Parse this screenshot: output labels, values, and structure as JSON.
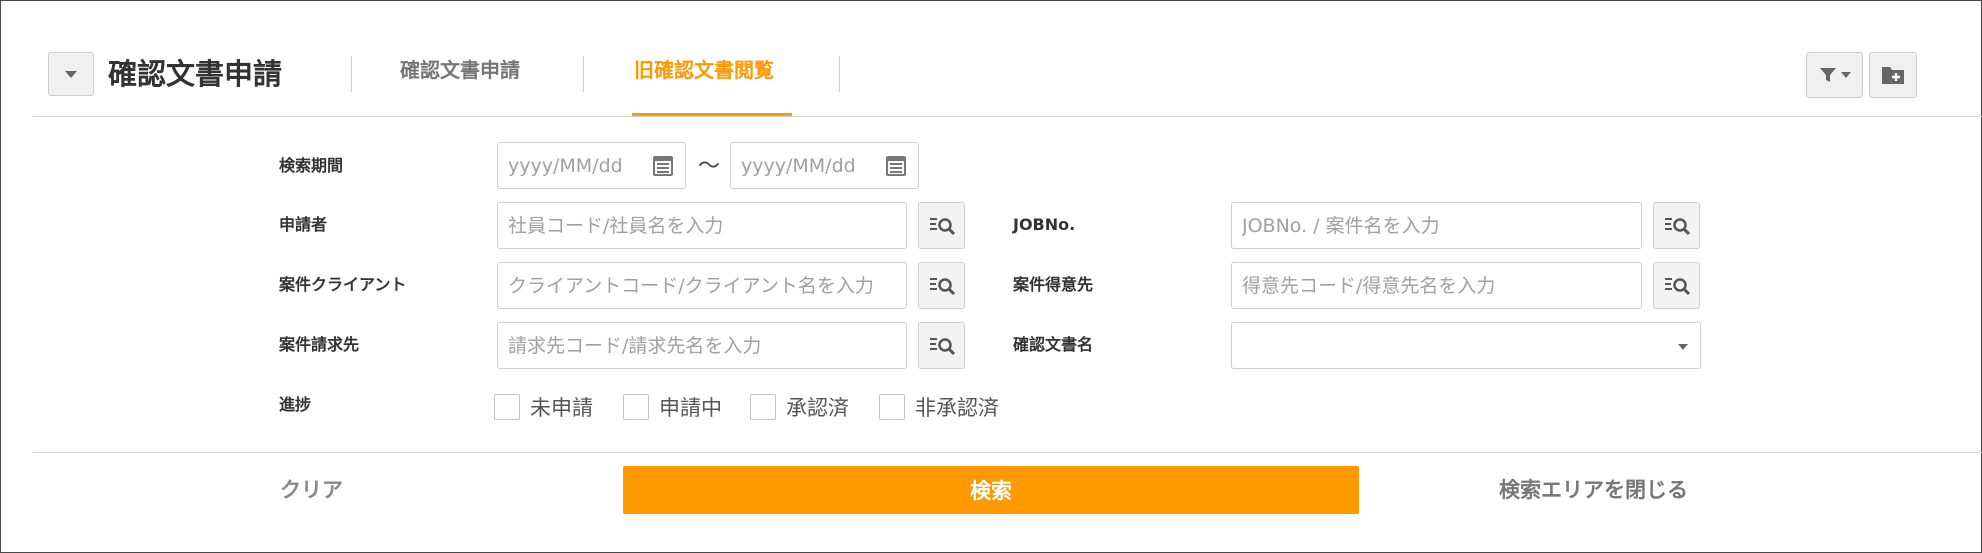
{
  "header": {
    "title": "確認文書申請",
    "tabs": [
      {
        "label": "確認文書申請",
        "active": false
      },
      {
        "label": "旧確認文書閲覧",
        "active": true
      }
    ],
    "icons": {
      "collapse": "chevron-down-icon",
      "filter": "filter-icon",
      "add_folder": "folder-plus-icon"
    }
  },
  "form": {
    "period": {
      "label": "検索期間",
      "from_placeholder": "yyyy/MM/dd",
      "to_placeholder": "yyyy/MM/dd",
      "separator": "〜"
    },
    "applicant": {
      "label": "申請者",
      "placeholder": "社員コード/社員名を入力"
    },
    "job_no": {
      "label": "JOBNo.",
      "placeholder": "JOBNo. / 案件名を入力"
    },
    "client": {
      "label": "案件クライアント",
      "placeholder": "クライアントコード/クライアント名を入力"
    },
    "customer": {
      "label": "案件得意先",
      "placeholder": "得意先コード/得意先名を入力"
    },
    "billing": {
      "label": "案件請求先",
      "placeholder": "請求先コード/請求先名を入力"
    },
    "doc_name": {
      "label": "確認文書名",
      "value": ""
    },
    "progress": {
      "label": "進捗",
      "options": [
        {
          "label": "未申請",
          "checked": false
        },
        {
          "label": "申請中",
          "checked": false
        },
        {
          "label": "承認済",
          "checked": false
        },
        {
          "label": "非承認済",
          "checked": false
        }
      ]
    }
  },
  "footer": {
    "clear_label": "クリア",
    "search_label": "検索",
    "close_label": "検索エリアを閉じる"
  },
  "colors": {
    "accent": "#ff9900",
    "border": "#cfcfcf",
    "text": "#333333"
  }
}
